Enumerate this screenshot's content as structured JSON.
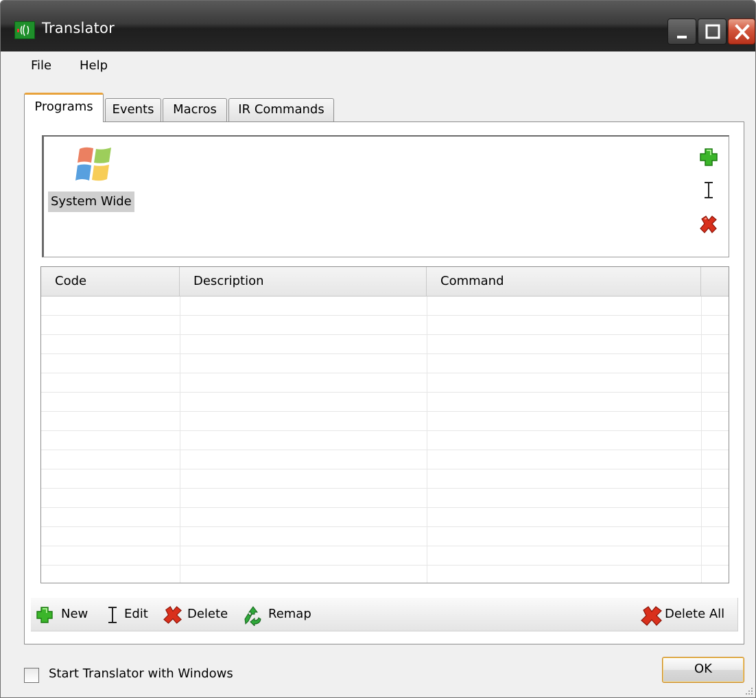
{
  "window": {
    "title": "Translator",
    "caption_buttons": [
      "minimize-icon",
      "maximize-icon",
      "close-icon"
    ]
  },
  "menu": {
    "items": [
      "File",
      "Help"
    ]
  },
  "tabs": [
    {
      "label": "Programs",
      "active": true
    },
    {
      "label": "Events",
      "active": false
    },
    {
      "label": "Macros",
      "active": false
    },
    {
      "label": "IR Commands",
      "active": false
    }
  ],
  "programs": {
    "items": [
      {
        "label": "System Wide",
        "icon": "windows-logo-icon",
        "selected": true
      }
    ],
    "side_buttons": [
      "add-icon",
      "edit-icon",
      "delete-icon"
    ]
  },
  "grid": {
    "columns": [
      "Code",
      "Description",
      "Command"
    ],
    "rows": []
  },
  "toolbar": {
    "new_label": "New",
    "edit_label": "Edit",
    "delete_label": "Delete",
    "remap_label": "Remap",
    "delete_all_label": "Delete All"
  },
  "footer": {
    "startup_label": "Start Translator with Windows",
    "startup_checked": false,
    "ok_label": "OK"
  },
  "colors": {
    "active_tab_accent": "#e8a23b",
    "add_green": "#3bb52a",
    "delete_red": "#d9301c"
  }
}
